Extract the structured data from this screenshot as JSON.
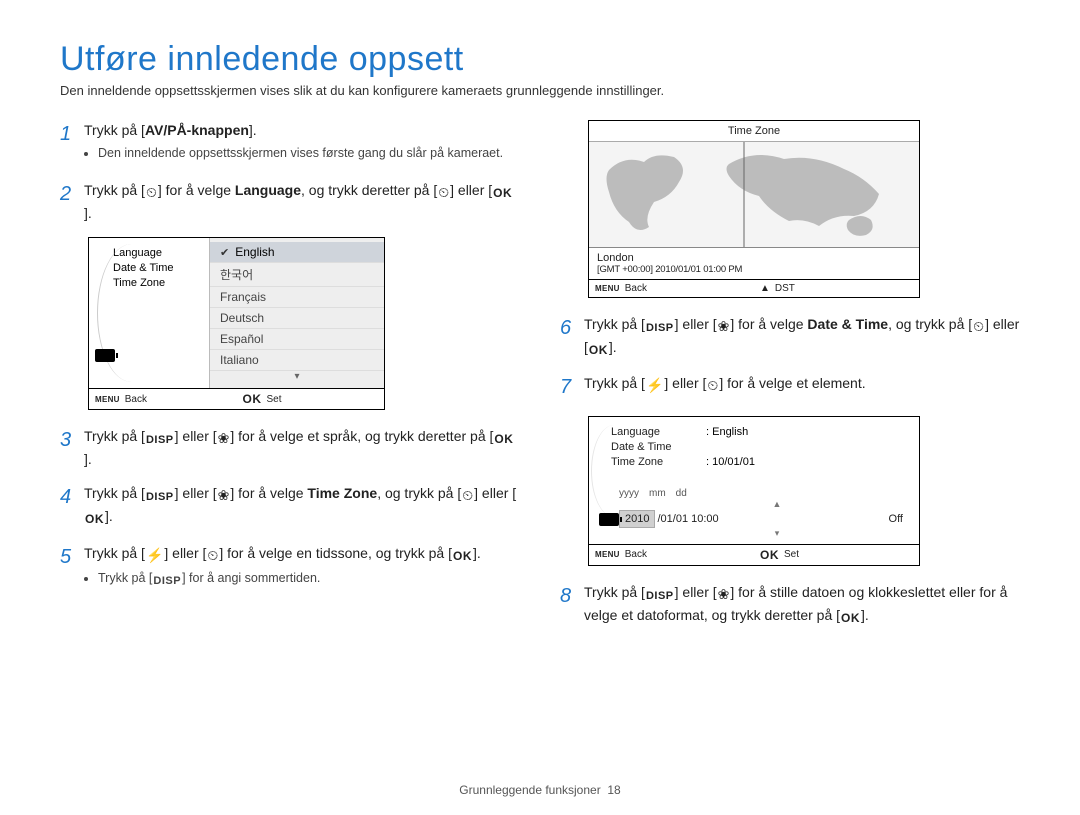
{
  "title": "Utføre innledende oppsett",
  "intro": "Den inneldende oppsettsskjermen vises slik at du kan konfigurere kameraets grunnleggende innstillinger.",
  "icons": {
    "disp": "DISP",
    "ok": "OK",
    "menu": "MENU",
    "timer": "⏲",
    "flash": "⚡",
    "macro": "❀",
    "up": "▲",
    "down": "▾"
  },
  "steps": {
    "s1": {
      "pre": "Trykk på [",
      "bold": "AV/PÅ-knappen",
      "post": "].",
      "bullet": "Den inneldende oppsettsskjermen vises første gang du slår på kameraet."
    },
    "s2": {
      "a": "Trykk på [",
      "b": "] for å velge ",
      "bold": "Language",
      "c": ", og trykk deretter på [",
      "d": "] eller [",
      "e": "]."
    },
    "s3": {
      "a": "Trykk på [",
      "b": "] eller [",
      "c": "] for å velge et språk, og trykk deretter på [",
      "d": "]."
    },
    "s4": {
      "a": "Trykk på [",
      "b": "] eller [",
      "c": "] for å velge ",
      "bold": "Time Zone",
      "d": ", og trykk på [",
      "e": "] eller [",
      "f": "]."
    },
    "s5": {
      "a": "Trykk på [",
      "b": "] eller [",
      "c": "] for å velge en tidssone, og trykk på [",
      "d": "].",
      "bullet_a": "Trykk på [",
      "bullet_b": "] for å angi sommertiden."
    },
    "s6": {
      "a": "Trykk på [",
      "b": "] eller [",
      "c": "] for å velge ",
      "bold": "Date & Time",
      "d": ", og trykk på [",
      "e": "] eller [",
      "f": "]."
    },
    "s7": {
      "a": "Trykk på [",
      "b": "] eller [",
      "c": "] for å velge et element."
    },
    "s8": {
      "a": "Trykk på [",
      "b": "] eller [",
      "c": "] for å stille datoen og klokkeslettet eller for å velge et datoformat, og trykk deretter på [",
      "d": "]."
    }
  },
  "lang_panel": {
    "left": {
      "language": "Language",
      "datetime": "Date & Time",
      "timezone": "Time Zone"
    },
    "options": [
      "English",
      "한국어",
      "Français",
      "Deutsch",
      "Español",
      "Italiano"
    ],
    "footer": {
      "back": "Back",
      "set": "Set"
    }
  },
  "tz_panel": {
    "head": "Time Zone",
    "city": "London",
    "gmt": "[GMT +00:00] 2010/01/01 01:00 PM",
    "footer": {
      "back": "Back",
      "dst": "DST"
    }
  },
  "dt_panel": {
    "rows": {
      "language_k": "Language",
      "language_v": ": English",
      "datetime_k": "Date & Time",
      "timezone_k": "Time Zone",
      "timezone_v": ": 10/01/01"
    },
    "fields": {
      "y": "yyyy",
      "m": "mm",
      "d": "dd"
    },
    "values": {
      "year": "2010",
      "rest": "/01/01  10:00",
      "off": "Off"
    },
    "footer": {
      "back": "Back",
      "set": "Set"
    }
  },
  "footer": {
    "label": "Grunnleggende funksjoner",
    "page": "18"
  }
}
